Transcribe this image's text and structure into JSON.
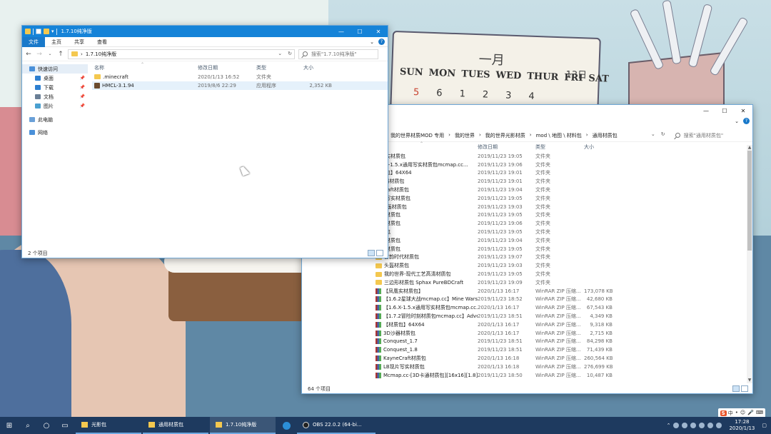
{
  "calendar": {
    "month": "一月",
    "day": "13日",
    "weekdays": [
      "SUN",
      "MON",
      "TUES",
      "WED",
      "THUR",
      "FRI",
      "SAT"
    ],
    "dates": [
      "5",
      "6",
      "1",
      "2",
      "3",
      "4"
    ]
  },
  "window1": {
    "title": "1.7.10纯净版",
    "ribbon_tabs": [
      "文件",
      "主页",
      "共享",
      "查看"
    ],
    "address": "1.7.10纯净版",
    "search_placeholder": "搜索\"1.7.10纯净版\"",
    "nav": [
      {
        "label": "快速访问",
        "pinned": false
      },
      {
        "label": "桌面",
        "pinned": true
      },
      {
        "label": "下载",
        "pinned": true
      },
      {
        "label": "文档",
        "pinned": true
      },
      {
        "label": "图片",
        "pinned": true
      },
      {
        "label": "此电脑",
        "pinned": false
      },
      {
        "label": "网络",
        "pinned": false
      }
    ],
    "columns": {
      "name": "名称",
      "date": "修改日期",
      "type": "类型",
      "size": "大小"
    },
    "rows": [
      {
        "name": ".minecraft",
        "date": "2020/1/13 16:52",
        "type": "文件夹",
        "size": "",
        "icon": "folder-icon"
      },
      {
        "name": "HMCL-3.1.94",
        "date": "2019/8/6 22:29",
        "type": "应用程序",
        "size": "2,352 KB",
        "icon": "app-icon"
      }
    ],
    "status": "2 个项目"
  },
  "window2": {
    "breadcrumbs": [
      "我的世界材质MOD 专用",
      "我的世界",
      "我的世界光影材质",
      "mod \\ 地图 \\ 材料包",
      "通用材质包"
    ],
    "search_placeholder": "搜索\"通用材质包\"",
    "columns": {
      "date": "修改日期",
      "type": "类型",
      "size": "大小"
    },
    "rows": [
      {
        "name": "回国实材质包",
        "date": "2019/11/23 19:05",
        "type": "文件夹",
        "size": "",
        "icon": "folder-icon"
      },
      {
        "name": "1.6.X-1.5.x通用写实材质包mcmap.cc...",
        "date": "2019/11/23 19:06",
        "type": "文件夹",
        "size": "",
        "icon": "folder-icon"
      },
      {
        "name": "材质包】64X64",
        "date": "2019/11/23 19:01",
        "type": "文件夹",
        "size": "",
        "icon": "folder-icon"
      },
      {
        "name": "D沙器材质包",
        "date": "2019/11/23 19:01",
        "type": "文件夹",
        "size": "",
        "icon": "folder-icon"
      },
      {
        "name": "neCraft材质包",
        "date": "2019/11/23 19:04",
        "type": "文件夹",
        "size": "",
        "icon": "folder-icon"
      },
      {
        "name": "现片写实材质包",
        "date": "2019/11/23 19:05",
        "type": "文件夹",
        "size": "",
        "icon": "folder-icon"
      },
      {
        "name": "on动画材质包",
        "date": "2019/11/23 19:03",
        "type": "文件夹",
        "size": "",
        "icon": "folder-icon"
      },
      {
        "name": "现代材质包",
        "date": "2019/11/23 19:05",
        "type": "文件夹",
        "size": "",
        "icon": "folder-icon"
      },
      {
        "name": "写实材质包",
        "date": "2019/11/23 19:06",
        "type": "文件夹",
        "size": "",
        "icon": "folder-icon"
      },
      {
        "name": "材质包",
        "date": "2019/11/23 19:05",
        "type": "文件夹",
        "size": "",
        "icon": "folder-icon"
      },
      {
        "name": "城市材质包",
        "date": "2019/11/23 19:04",
        "type": "文件夹",
        "size": "",
        "icon": "folder-icon"
      },
      {
        "name": "写实材质包",
        "date": "2019/11/23 19:05",
        "type": "文件夹",
        "size": "",
        "icon": "folder-icon"
      },
      {
        "name": "古韵时代材质包",
        "date": "2019/11/23 19:07",
        "type": "文件夹",
        "size": "",
        "icon": "folder-icon"
      },
      {
        "name": "头盔材质包",
        "date": "2019/11/23 19:03",
        "type": "文件夹",
        "size": "",
        "icon": "folder-icon"
      },
      {
        "name": "我的世界-现代工艺高清材质包",
        "date": "2019/11/23 19:05",
        "type": "文件夹",
        "size": "",
        "icon": "folder-icon"
      },
      {
        "name": "三边形材质包 Sphax PureBDCraft",
        "date": "2019/11/23 19:09",
        "type": "文件夹",
        "size": "",
        "icon": "folder-icon"
      },
      {
        "name": "【凤凰实材质包】",
        "date": "2020/1/13 16:17",
        "type": "WinRAR ZIP 压缩...",
        "size": "173,078 KB",
        "icon": "rar-icon"
      },
      {
        "name": "【1.6.2星球大战mcmap.cc】Mine Wars",
        "date": "2019/11/23 18:52",
        "type": "WinRAR ZIP 压缩...",
        "size": "42,680 KB",
        "icon": "rar-icon"
      },
      {
        "name": "【1.6.X-1.5.x通用写实材质包mcmap.cc...",
        "date": "2020/1/13 16:17",
        "type": "WinRAR ZIP 压缩...",
        "size": "67,543 KB",
        "icon": "rar-icon"
      },
      {
        "name": "【1.7.2冒险时刻材质包mcmap.cc】Adven...",
        "date": "2019/11/23 18:51",
        "type": "WinRAR ZIP 压缩...",
        "size": "4,349 KB",
        "icon": "rar-icon"
      },
      {
        "name": "【材质包】64X64",
        "date": "2020/1/13 16:17",
        "type": "WinRAR ZIP 压缩...",
        "size": "9,318 KB",
        "icon": "rar-icon"
      },
      {
        "name": "3D沙器材质包",
        "date": "2020/1/13 16:17",
        "type": "WinRAR ZIP 压缩...",
        "size": "2,715 KB",
        "icon": "rar-icon"
      },
      {
        "name": "Conquest_1.7",
        "date": "2019/11/23 18:51",
        "type": "WinRAR ZIP 压缩...",
        "size": "84,298 KB",
        "icon": "rar-icon"
      },
      {
        "name": "Conquest_1.8",
        "date": "2019/11/23 18:51",
        "type": "WinRAR ZIP 压缩...",
        "size": "71,439 KB",
        "icon": "rar-icon"
      },
      {
        "name": "KayneCraft材质包",
        "date": "2020/1/13 16:18",
        "type": "WinRAR ZIP 压缩...",
        "size": "260,564 KB",
        "icon": "rar-icon"
      },
      {
        "name": "LB现片写实材质包",
        "date": "2020/1/13 16:18",
        "type": "WinRAR ZIP 压缩...",
        "size": "276,699 KB",
        "icon": "rar-icon"
      },
      {
        "name": "Mcmap.cc-[3D卡通材质包][16x16][1.8]",
        "date": "2019/11/23 18:50",
        "type": "WinRAR ZIP 压缩...",
        "size": "10,487 KB",
        "icon": "rar-icon"
      }
    ],
    "status": "64 个项目"
  },
  "taskbar": {
    "tasks": [
      {
        "label": "光影包",
        "kind": "folder"
      },
      {
        "label": "通用材质包",
        "kind": "folder"
      },
      {
        "label": "1.7.10纯净版",
        "kind": "folder",
        "active": true
      },
      {
        "label": "",
        "kind": "edge"
      },
      {
        "label": "OBS 22.0.2 (64-bi...",
        "kind": "obs"
      }
    ],
    "time": "17:28",
    "date": "2020/1/13",
    "ime": [
      "中",
      "•",
      "☺",
      "🎤",
      "⌨"
    ]
  }
}
